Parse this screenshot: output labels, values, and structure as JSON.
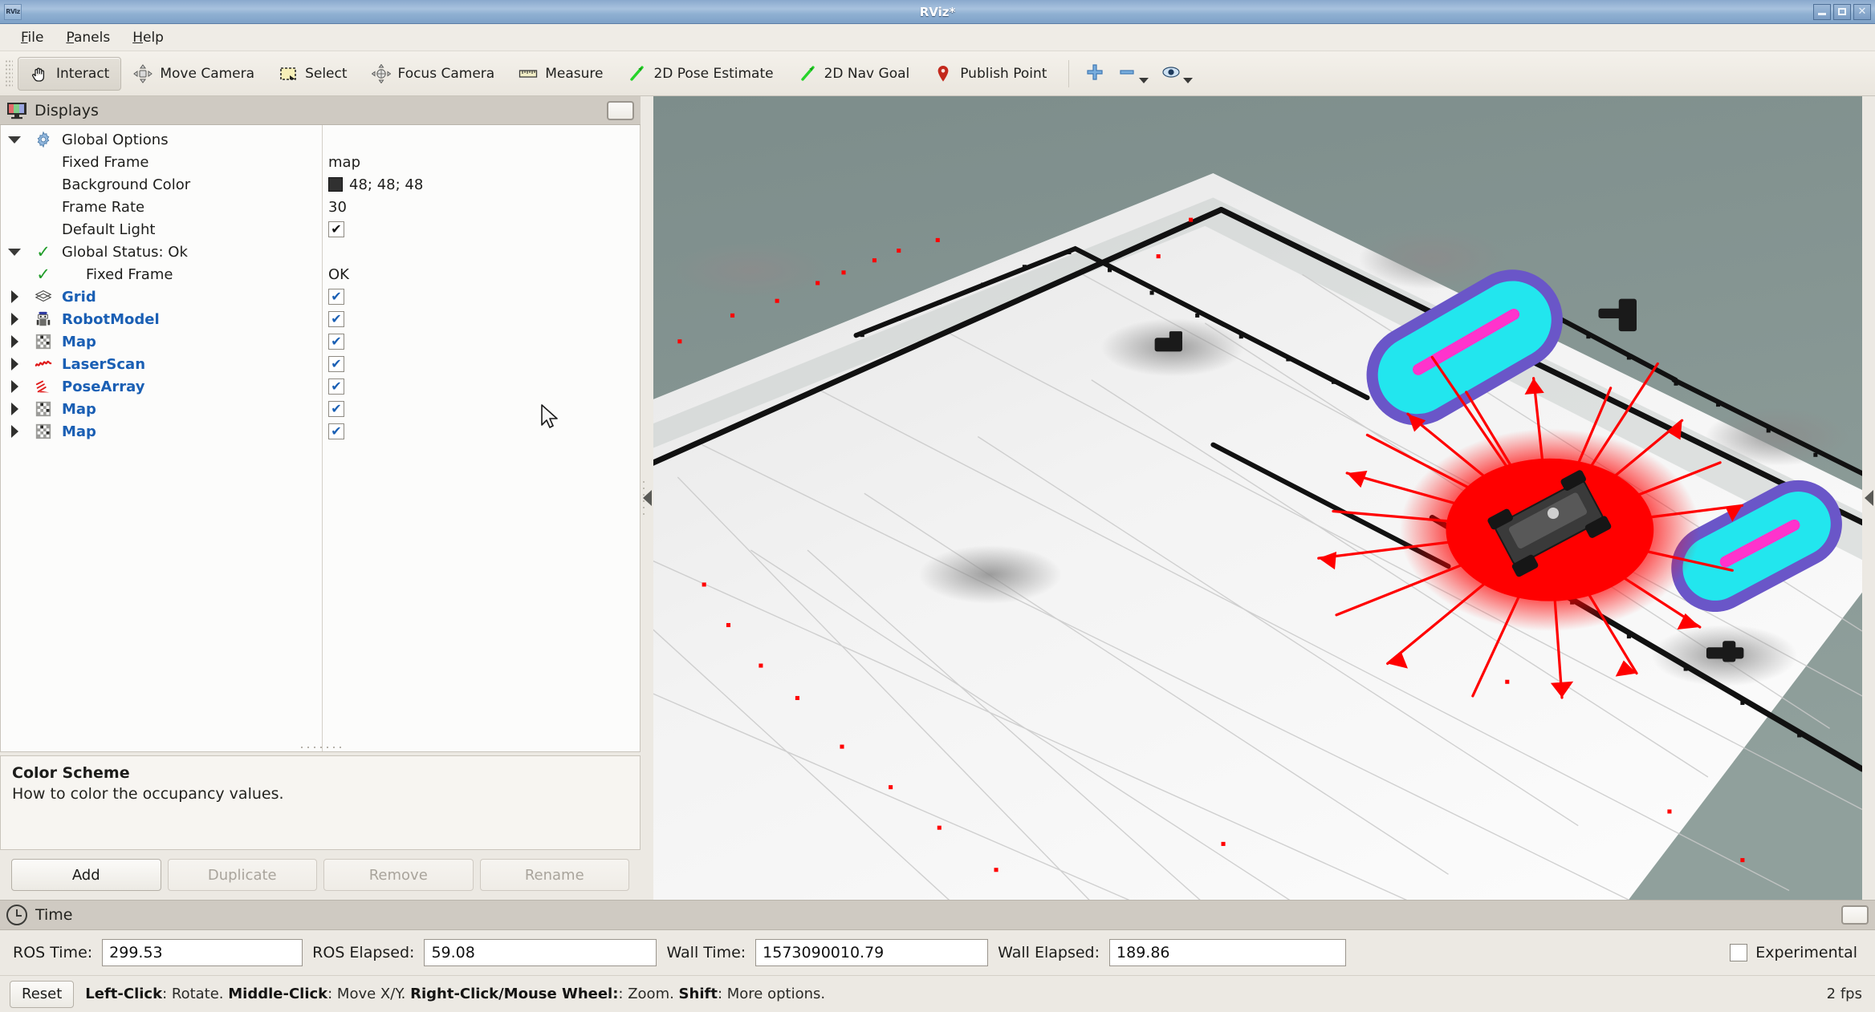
{
  "window": {
    "title": "RViz*",
    "icon_label": "RViz",
    "controls": {
      "minimize": "–",
      "maximize": "❐",
      "close": "✕"
    }
  },
  "menubar": {
    "items": [
      {
        "label": "File",
        "mnemonic": "F"
      },
      {
        "label": "Panels",
        "mnemonic": "P"
      },
      {
        "label": "Help",
        "mnemonic": "H"
      }
    ]
  },
  "toolbar": {
    "tools": [
      {
        "label": "Interact",
        "icon": "hand-icon",
        "active": true
      },
      {
        "label": "Move Camera",
        "icon": "move-camera-icon",
        "active": false
      },
      {
        "label": "Select",
        "icon": "select-rectangle-icon",
        "active": false
      },
      {
        "label": "Focus Camera",
        "icon": "focus-camera-icon",
        "active": false
      },
      {
        "label": "Measure",
        "icon": "ruler-icon",
        "active": false
      },
      {
        "label": "2D Pose Estimate",
        "icon": "green-arrow-icon",
        "active": false
      },
      {
        "label": "2D Nav Goal",
        "icon": "green-arrow-icon",
        "active": false
      },
      {
        "label": "Publish Point",
        "icon": "map-pin-icon",
        "active": false
      }
    ],
    "extras": [
      {
        "icon": "plus-icon",
        "has_caret": false
      },
      {
        "icon": "minus-icon",
        "has_caret": true
      },
      {
        "icon": "eye-icon",
        "has_caret": true
      }
    ]
  },
  "displays_panel": {
    "header": {
      "title": "Displays",
      "icon": "displays-monitor-icon"
    },
    "tree": [
      {
        "name": "Global Options",
        "value": "",
        "expander": "down",
        "icon": "gear-icon",
        "style": "plain",
        "indent": 0
      },
      {
        "name": "Fixed Frame",
        "value": "map",
        "expander": "none",
        "icon": "none",
        "style": "plain",
        "indent": 0
      },
      {
        "name": "Background Color",
        "value": "48; 48; 48",
        "expander": "none",
        "icon": "none",
        "style": "plain",
        "indent": 0,
        "swatch": "#303030"
      },
      {
        "name": "Frame Rate",
        "value": "30",
        "expander": "none",
        "icon": "none",
        "style": "plain",
        "indent": 0
      },
      {
        "name": "Default Light",
        "value": "",
        "expander": "none",
        "icon": "none",
        "style": "plain",
        "indent": 0,
        "checkbox": "black"
      },
      {
        "name": "Global Status: Ok",
        "value": "",
        "expander": "down",
        "icon": "green-check-icon",
        "style": "plain",
        "indent": 0
      },
      {
        "name": "Fixed Frame",
        "value": "OK",
        "expander": "none",
        "icon": "green-check-icon",
        "style": "plain",
        "indent": 1
      },
      {
        "name": "Grid",
        "value": "",
        "expander": "right",
        "icon": "grid-icon",
        "style": "display",
        "indent": 0,
        "checkbox": "blue"
      },
      {
        "name": "RobotModel",
        "value": "",
        "expander": "right",
        "icon": "robot-icon",
        "style": "display",
        "indent": 0,
        "checkbox": "blue"
      },
      {
        "name": "Map",
        "value": "",
        "expander": "right",
        "icon": "map-icon",
        "style": "display",
        "indent": 0,
        "checkbox": "blue"
      },
      {
        "name": "LaserScan",
        "value": "",
        "expander": "right",
        "icon": "laserscan-icon",
        "style": "display",
        "indent": 0,
        "checkbox": "blue"
      },
      {
        "name": "PoseArray",
        "value": "",
        "expander": "right",
        "icon": "posearray-icon",
        "style": "display",
        "indent": 0,
        "checkbox": "blue"
      },
      {
        "name": "Map",
        "value": "",
        "expander": "right",
        "icon": "map-icon",
        "style": "display",
        "indent": 0,
        "checkbox": "blue"
      },
      {
        "name": "Map",
        "value": "",
        "expander": "right",
        "icon": "map-icon",
        "style": "display",
        "indent": 0,
        "checkbox": "blue"
      }
    ],
    "help": {
      "title": "Color Scheme",
      "text": "How to color the occupancy values."
    },
    "buttons": [
      {
        "label": "Add",
        "enabled": true
      },
      {
        "label": "Duplicate",
        "enabled": false
      },
      {
        "label": "Remove",
        "enabled": false
      },
      {
        "label": "Rename",
        "enabled": false
      }
    ]
  },
  "viewport": {
    "background_color": "#7f8f8c",
    "floor_color": "#f2f2f2",
    "wall_color": "#141414",
    "laser_color": "#ff0000",
    "costmap_inner_color": "#22e6ee",
    "costmap_outer_color": "#6a56c8",
    "path_color": "#ff33cc",
    "robot_color": "#333333"
  },
  "time_panel": {
    "header": {
      "title": "Time",
      "icon": "clock-icon"
    },
    "fields": [
      {
        "label": "ROS Time:",
        "value": "299.53"
      },
      {
        "label": "ROS Elapsed:",
        "value": "59.08"
      },
      {
        "label": "Wall Time:",
        "value": "1573090010.79"
      },
      {
        "label": "Wall Elapsed:",
        "value": "189.86"
      }
    ],
    "experimental": {
      "label": "Experimental",
      "checked": false
    }
  },
  "statusbar": {
    "reset_label": "Reset",
    "hint_parts": [
      {
        "text": "Left-Click",
        "bold": true
      },
      {
        "text": ": Rotate.  ",
        "bold": false
      },
      {
        "text": "Middle-Click",
        "bold": true
      },
      {
        "text": ": Move X/Y.  ",
        "bold": false
      },
      {
        "text": "Right-Click/Mouse Wheel:",
        "bold": true
      },
      {
        "text": ": Zoom.  ",
        "bold": false
      },
      {
        "text": "Shift",
        "bold": true
      },
      {
        "text": ": More options.",
        "bold": false
      }
    ],
    "fps": "2 fps"
  }
}
